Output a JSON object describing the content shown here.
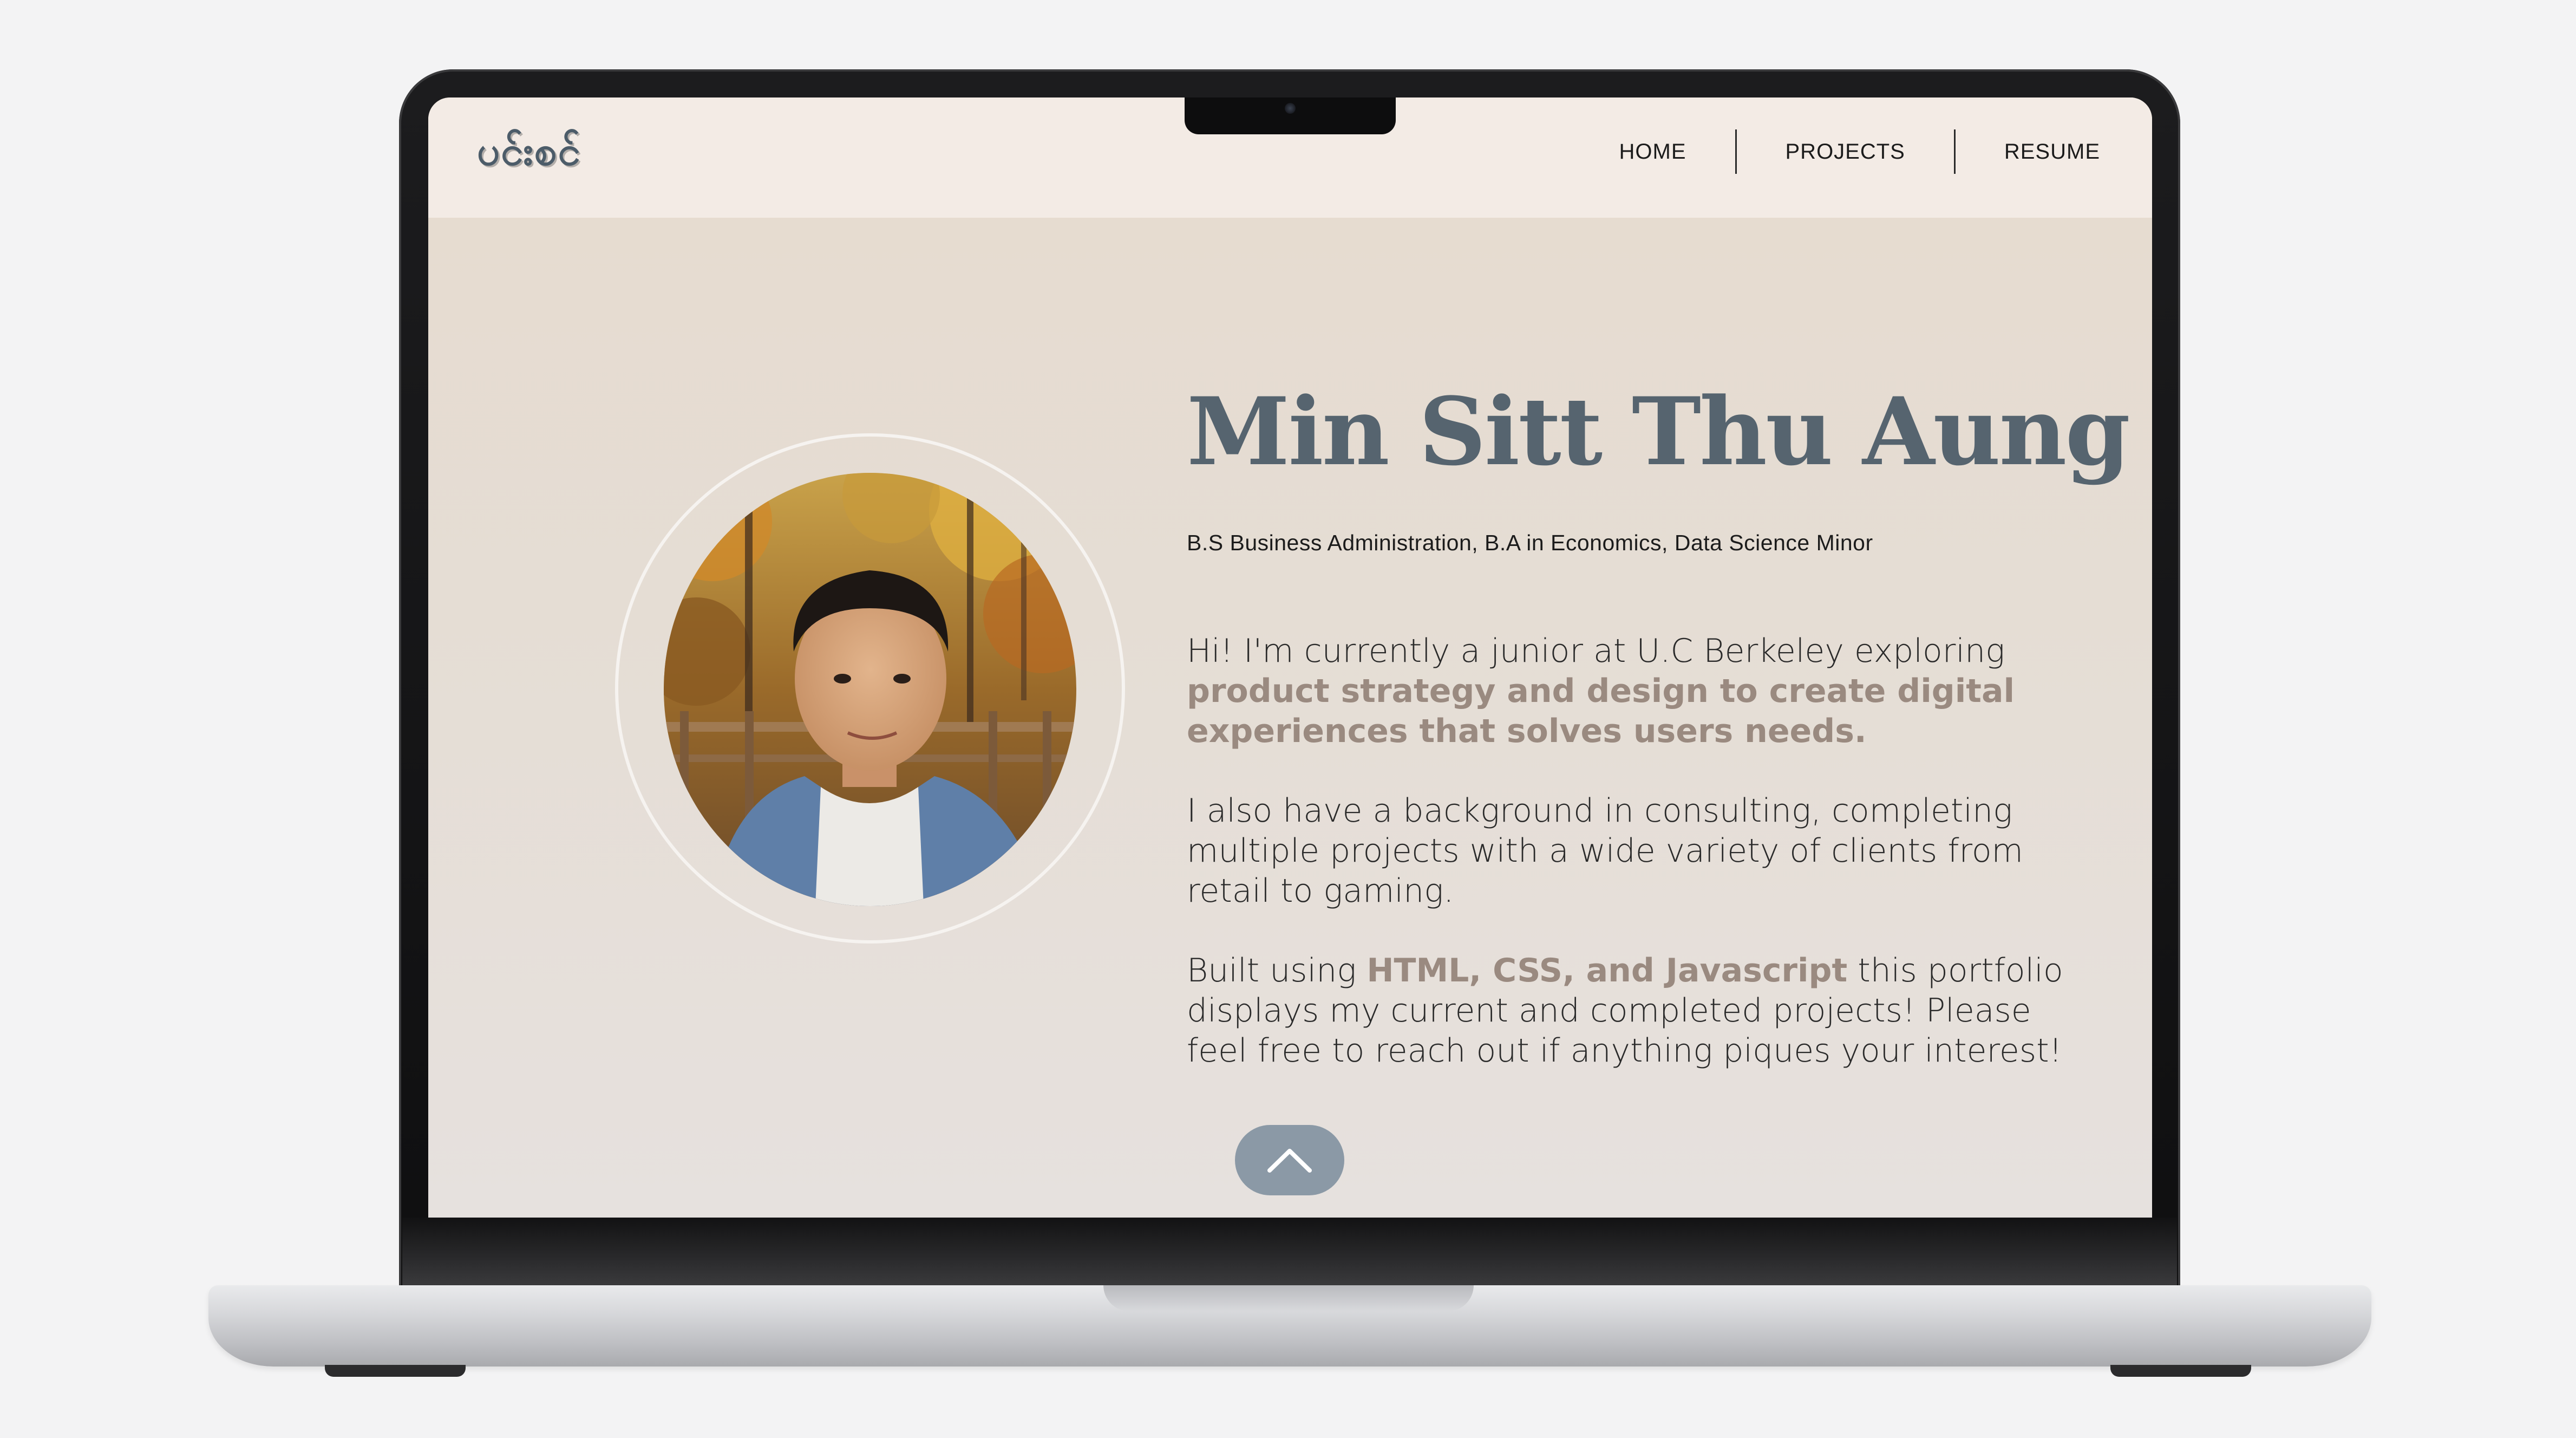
{
  "nav": {
    "logo_text": "ပင်းစင်",
    "links": [
      {
        "label": "HOME"
      },
      {
        "label": "PROJECTS"
      },
      {
        "label": "RESUME"
      }
    ]
  },
  "profile": {
    "name": "Min Sitt Thu Aung",
    "degree": "B.S Business Administration, B.A in Economics, Data Science Minor",
    "photo_icon": "profile-photo"
  },
  "bio": {
    "p1_intro": "Hi! I'm currently a junior at U.C Berkeley exploring ",
    "p1_highlight": "product strategy and design to create digital experiences that solves users needs.",
    "p2": "I also have a background in consulting, completing multiple projects with a wide variety of clients from retail to gaming.",
    "p3_intro": "Built using ",
    "p3_highlight": "HTML, CSS, and Javascript",
    "p3_outro": " this portfolio displays my current and completed projects! Please feel free to reach out if anything piques your interest!"
  },
  "scroll_button": {
    "icon": "chevron-up-icon"
  },
  "colors": {
    "accent_slate": "#56646f",
    "highlight_taupe": "#9a8a80",
    "nav_bg": "#f3ebe5",
    "button_bg": "#8b99a6"
  }
}
